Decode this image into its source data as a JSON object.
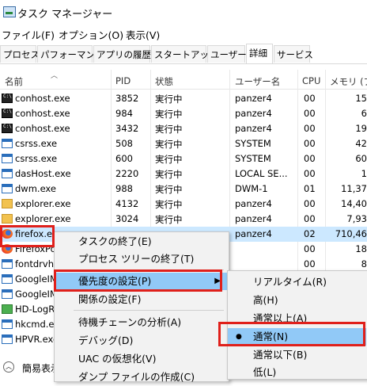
{
  "window": {
    "title": "タスク マネージャー"
  },
  "menubar": [
    "ファイル(F)",
    "オプション(O)",
    "表示(V)"
  ],
  "tabs": [
    "プロセス",
    "パフォーマンス",
    "アプリの履歴",
    "スタートアップ",
    "ユーザー",
    "詳細",
    "サービス"
  ],
  "active_tab": "詳細",
  "columns": [
    "名前",
    "PID",
    "状態",
    "ユーザー名",
    "CPU",
    "メモリ (プラ"
  ],
  "rows": [
    {
      "name": "conhost.exe",
      "pid": "3852",
      "status": "実行中",
      "user": "panzer4",
      "cpu": "00",
      "mem": "15",
      "icon": "console-icon"
    },
    {
      "name": "conhost.exe",
      "pid": "984",
      "status": "実行中",
      "user": "panzer4",
      "cpu": "00",
      "mem": "6",
      "icon": "console-icon"
    },
    {
      "name": "conhost.exe",
      "pid": "3432",
      "status": "実行中",
      "user": "panzer4",
      "cpu": "00",
      "mem": "19",
      "icon": "console-icon"
    },
    {
      "name": "csrss.exe",
      "pid": "508",
      "status": "実行中",
      "user": "SYSTEM",
      "cpu": "00",
      "mem": "42",
      "icon": "window-icon"
    },
    {
      "name": "csrss.exe",
      "pid": "600",
      "status": "実行中",
      "user": "SYSTEM",
      "cpu": "00",
      "mem": "60",
      "icon": "window-icon"
    },
    {
      "name": "dasHost.exe",
      "pid": "2220",
      "status": "実行中",
      "user": "LOCAL SE...",
      "cpu": "00",
      "mem": "1",
      "icon": "window-icon"
    },
    {
      "name": "dwm.exe",
      "pid": "988",
      "status": "実行中",
      "user": "DWM-1",
      "cpu": "01",
      "mem": "11,37",
      "icon": "window-icon"
    },
    {
      "name": "explorer.exe",
      "pid": "4132",
      "status": "実行中",
      "user": "panzer4",
      "cpu": "00",
      "mem": "14,40",
      "icon": "explorer-icon"
    },
    {
      "name": "explorer.exe",
      "pid": "3024",
      "status": "実行中",
      "user": "panzer4",
      "cpu": "00",
      "mem": "7,93",
      "icon": "explorer-icon"
    },
    {
      "name": "firefox.exe",
      "pid": "",
      "status": "",
      "user": "panzer4",
      "cpu": "02",
      "mem": "710,46",
      "icon": "firefox-icon"
    },
    {
      "name": "FirefoxPo",
      "pid": "",
      "status": "",
      "user": "",
      "cpu": "00",
      "mem": "18",
      "icon": "firefox-icon"
    },
    {
      "name": "fontdrvho",
      "pid": "",
      "status": "",
      "user": "",
      "cpu": "00",
      "mem": "8",
      "icon": "window-icon"
    },
    {
      "name": "GoogleIM",
      "pid": "",
      "status": "",
      "user": "",
      "cpu": "",
      "mem": "",
      "icon": "window-icon"
    },
    {
      "name": "GoogleIM",
      "pid": "",
      "status": "",
      "user": "",
      "cpu": "",
      "mem": "",
      "icon": "window-icon"
    },
    {
      "name": "HD-LogR",
      "pid": "",
      "status": "",
      "user": "",
      "cpu": "",
      "mem": "",
      "icon": "green-icon"
    },
    {
      "name": "hkcmd.ex",
      "pid": "",
      "status": "",
      "user": "",
      "cpu": "",
      "mem": "",
      "icon": "window-icon"
    },
    {
      "name": "HPVR.exe",
      "pid": "",
      "status": "",
      "user": "",
      "cpu": "",
      "mem": "",
      "icon": "window-icon"
    }
  ],
  "context_menu": {
    "items": [
      "タスクの終了(E)",
      "プロセス ツリーの終了(T)",
      "優先度の設定(P)",
      "関係の設定(F)",
      "待機チェーンの分析(A)",
      "デバッグ(D)",
      "UAC の仮想化(V)",
      "ダンプ ファイルの作成(C)"
    ],
    "submenu_arrow": "▶"
  },
  "priority_menu": {
    "items": [
      "リアルタイム(R)",
      "高(H)",
      "通常以上(A)",
      "通常(N)",
      "通常以下(B)",
      "低(L)"
    ],
    "selected_marker": "●"
  },
  "footer": {
    "label": "簡易表示"
  },
  "colors": {
    "selection": "#cce8ff",
    "menu_highlight": "#91c9f7",
    "annotation_red": "#e0201b"
  }
}
